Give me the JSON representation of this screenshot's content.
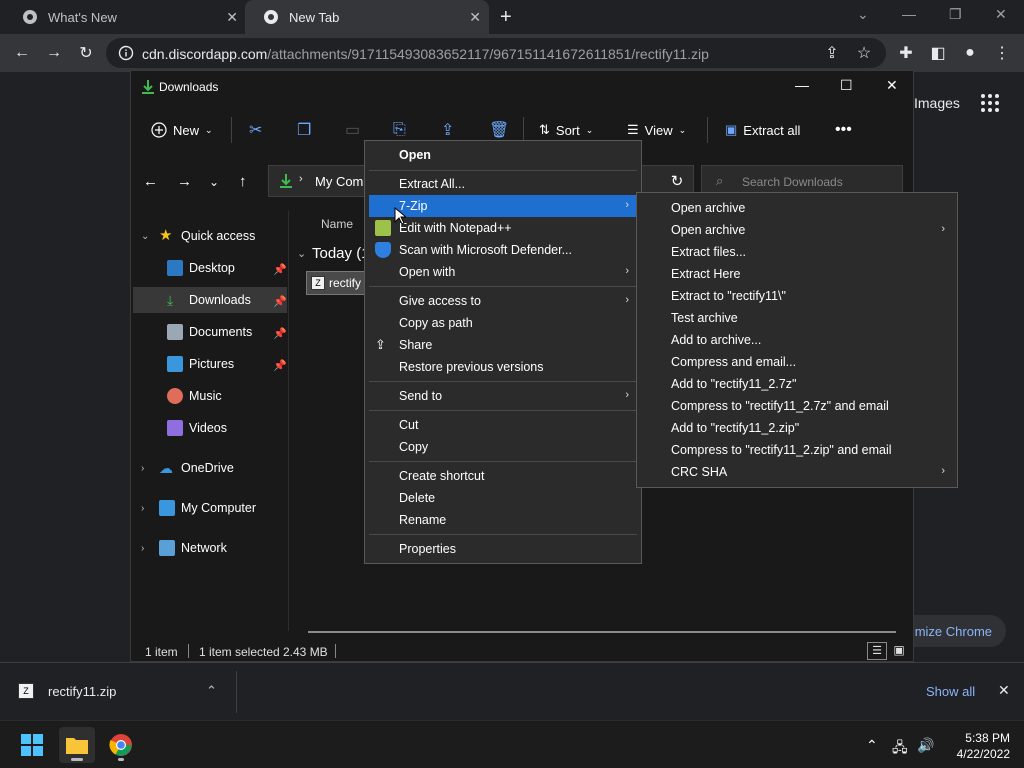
{
  "browser": {
    "tabs": [
      {
        "title": "What's New",
        "active": false
      },
      {
        "title": "New Tab",
        "active": true
      }
    ],
    "url_host": "cdn.discordapp.com",
    "url_path": "/attachments/917115493083652117/967151141672611851/rectify11.zip",
    "page": {
      "images_link": "Images",
      "customize_label": "mize Chrome"
    }
  },
  "explorer": {
    "title": "Downloads",
    "commands": {
      "new": "New",
      "sort": "Sort",
      "view": "View",
      "extract_all": "Extract all"
    },
    "breadcrumb": "My Comp",
    "search_placeholder": "Search Downloads",
    "nav": {
      "quick_access": "Quick access",
      "desktop": "Desktop",
      "downloads": "Downloads",
      "documents": "Documents",
      "pictures": "Pictures",
      "music": "Music",
      "videos": "Videos",
      "onedrive": "OneDrive",
      "my_computer": "My Computer",
      "network": "Network"
    },
    "column_name": "Name",
    "group_label": "Today (1",
    "file_label": "rectify",
    "status": {
      "count": "1 item",
      "selected": "1 item selected",
      "size": "2.43 MB"
    }
  },
  "context_menu": {
    "open": "Open",
    "extract_all": "Extract All...",
    "seven_zip": "7-Zip",
    "edit_notepad": "Edit with Notepad++",
    "scan_defender": "Scan with Microsoft Defender...",
    "open_with": "Open with",
    "give_access": "Give access to",
    "copy_as_path": "Copy as path",
    "share": "Share",
    "restore_versions": "Restore previous versions",
    "send_to": "Send to",
    "cut": "Cut",
    "copy": "Copy",
    "create_shortcut": "Create shortcut",
    "delete": "Delete",
    "rename": "Rename",
    "properties": "Properties"
  },
  "submenu": [
    {
      "label": "Open archive",
      "has_arrow": false
    },
    {
      "label": "Open archive",
      "has_arrow": true
    },
    {
      "label": "Extract files...",
      "has_arrow": false
    },
    {
      "label": "Extract Here",
      "has_arrow": false
    },
    {
      "label": "Extract to \"rectify11\\\"",
      "has_arrow": false
    },
    {
      "label": "Test archive",
      "has_arrow": false
    },
    {
      "label": "Add to archive...",
      "has_arrow": false
    },
    {
      "label": "Compress and email...",
      "has_arrow": false
    },
    {
      "label": "Add to \"rectify11_2.7z\"",
      "has_arrow": false
    },
    {
      "label": "Compress to \"rectify11_2.7z\" and email",
      "has_arrow": false
    },
    {
      "label": "Add to \"rectify11_2.zip\"",
      "has_arrow": false
    },
    {
      "label": "Compress to \"rectify11_2.zip\" and email",
      "has_arrow": false
    },
    {
      "label": "CRC SHA",
      "has_arrow": true
    }
  ],
  "download_shelf": {
    "file": "rectify11.zip",
    "show_all": "Show all"
  },
  "taskbar": {
    "time": "5:38 PM",
    "date": "4/22/2022"
  },
  "colors": {
    "menu_highlight": "#1e6fd0",
    "link_blue": "#8ab4f8",
    "accent_green": "#3fb950"
  }
}
